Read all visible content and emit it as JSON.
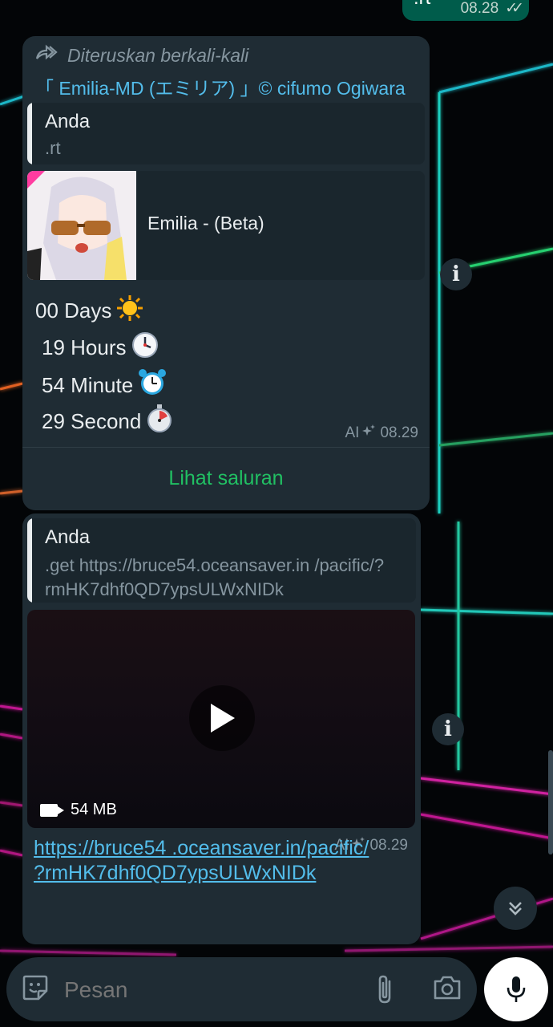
{
  "top_message": {
    "text": ".rt",
    "time": "08.28",
    "status": "read"
  },
  "message1": {
    "forwarded_label": "Diteruskan berkali-kali",
    "channel_name": "「 Emilia-MD (エミリア) 」© cifumo Ogiwara",
    "quote": {
      "author": "Anda",
      "text": ".rt"
    },
    "preview_title": "Emilia - (Beta)",
    "lines": [
      {
        "text": "00 Days",
        "emoji": "sun"
      },
      {
        "text": "19 Hours",
        "emoji": "clock"
      },
      {
        "text": "54 Minute",
        "emoji": "alarm-clock"
      },
      {
        "text": "29 Second",
        "emoji": "stopwatch"
      }
    ],
    "ai_label": "AI",
    "time": "08.29",
    "channel_button": "Lihat saluran"
  },
  "message2": {
    "quote": {
      "author": "Anda",
      "text": ".get https://bruce54.oceansaver.in /pacific/?rmHK7dhf0QD7ypsULWxNIDk"
    },
    "video_size": "54 MB",
    "link": "https://bruce54 .oceansaver.in/pacific/ ?rmHK7dhf0QD7ypsULWxNIDk",
    "ai_label": "AI",
    "time": "08.29"
  },
  "input": {
    "placeholder": "Pesan"
  },
  "colors": {
    "accent_green": "#21c063",
    "link_blue": "#53bdeb",
    "bubble": "#1f2c34",
    "outgoing": "#005c4b"
  }
}
